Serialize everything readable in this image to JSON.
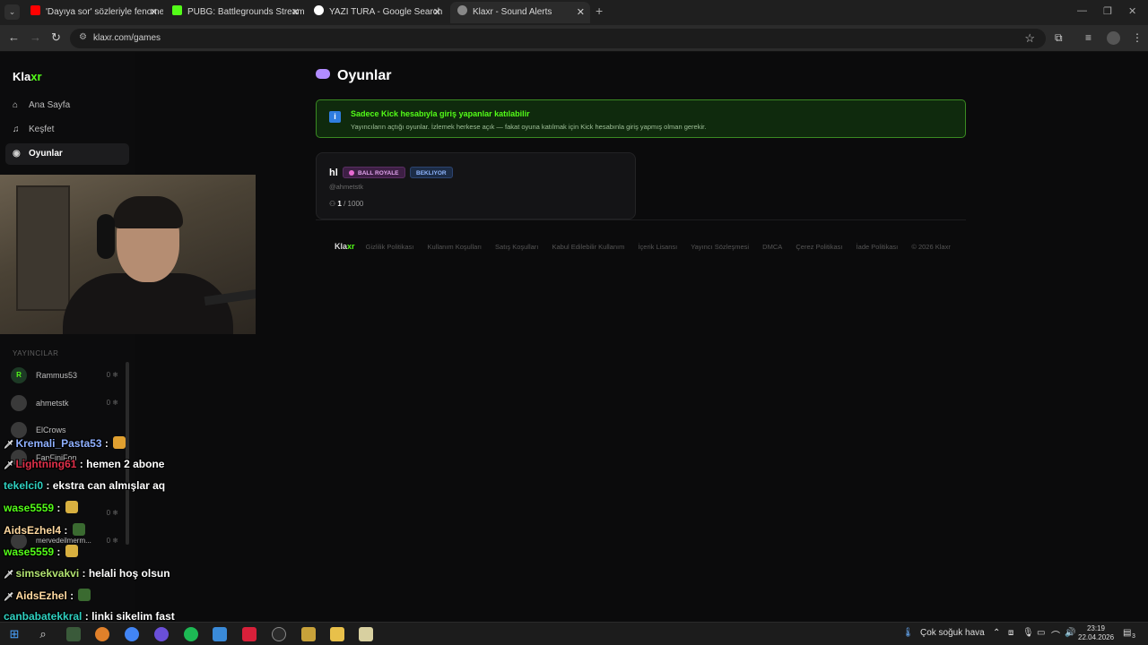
{
  "browser": {
    "tabs": [
      {
        "title": "'Dayıya sor' sözleriyle fenomen",
        "fav_color": "#ff0000"
      },
      {
        "title": "PUBG: Battlegrounds Streaming",
        "fav_color": "#53fc18"
      },
      {
        "title": "YAZI TURA - Google Search",
        "fav_color": "#ffffff"
      },
      {
        "title": "Klaxr - Sound Alerts",
        "fav_color": "#888888"
      }
    ],
    "url": "klaxr.com/games"
  },
  "sidebar": {
    "logo_main": "Kla",
    "logo_accent": "xr",
    "nav": [
      {
        "label": "Ana Sayfa",
        "icon": "home-icon"
      },
      {
        "label": "Keşfet",
        "icon": "music-icon"
      },
      {
        "label": "Oyunlar",
        "icon": "gamepad-icon"
      }
    ],
    "streamers_label": "YAYINCILAR",
    "streamers": [
      {
        "name": "Rammus53",
        "count": "0 ❄",
        "initial": "R"
      },
      {
        "name": "ahmetstk",
        "count": "0 ❄",
        "initial": ""
      },
      {
        "name": "ElCrows",
        "count": "",
        "initial": ""
      },
      {
        "name": "FanFiniFon",
        "count": "",
        "initial": ""
      },
      {
        "name": "",
        "count": "0 ❄",
        "initial": ""
      },
      {
        "name": "mervedeilmerm...",
        "count": "0 ❄",
        "initial": ""
      }
    ]
  },
  "main": {
    "title": "Oyunlar",
    "notice": {
      "title": "Sadece Kick hesabıyla giriş yapanlar katılabilir",
      "text": "Yayıncıların açtığı oyunlar. İzlemek herkese açık — fakat oyuna katılmak için Kick hesabınla giriş yapmış olman gerekir."
    },
    "game": {
      "title": "hl",
      "mode_badge": "BALL ROYALE",
      "status_badge": "BEKLIYOR",
      "host": "@ahmetstk",
      "players_current": "1",
      "players_max": "/ 1000"
    },
    "footer": {
      "logo_main": "Kla",
      "logo_accent": "xr",
      "links": [
        "Gizlilik Politikası",
        "Kullanım Koşulları",
        "Satış Koşulları",
        "Kabul Edilebilir Kullanım",
        "İçerik Lisansı",
        "Yayıncı Sözleşmesi",
        "DMCA",
        "Çerez Politikası",
        "İade Politikası",
        "© 2026 Klaxr"
      ]
    }
  },
  "chat": [
    {
      "user": "Kremali_Pasta53",
      "msg": "",
      "color": "#8fb0ff",
      "emote": "#e0a030",
      "sword": true
    },
    {
      "user": "Lightning61",
      "msg": "hemen 2 abone",
      "color": "#e0304a",
      "emote": "",
      "sword": true
    },
    {
      "user": "tekelci0",
      "msg": "ekstra can almışlar aq",
      "color": "#2fd0c0",
      "emote": "",
      "sword": false
    },
    {
      "user": "wase5559",
      "msg": "",
      "color": "#53fc18",
      "emote": "#d8b040",
      "sword": false
    },
    {
      "user": "AidsEzhel4",
      "msg": "",
      "color": "#ffd9a0",
      "emote": "#3a6a30",
      "sword": false
    },
    {
      "user": "wase5559",
      "msg": "",
      "color": "#53fc18",
      "emote": "#d8b040",
      "sword": false
    },
    {
      "user": "simsekvakvi",
      "msg": "helali hoş olsun",
      "color": "#b0e070",
      "emote": "",
      "sword": true
    },
    {
      "user": "AidsEzhel",
      "msg": "",
      "color": "#ffd9a0",
      "emote": "#3a6a30",
      "sword": true
    },
    {
      "user": "canbabatekkral",
      "msg": "linki sikelim fast",
      "color": "#2fd0c0",
      "emote": "",
      "sword": false
    }
  ],
  "taskbar": {
    "weather": "Çok soğuk hava",
    "time": "23:19",
    "date": "22.04.2026",
    "notif_count": "3"
  }
}
